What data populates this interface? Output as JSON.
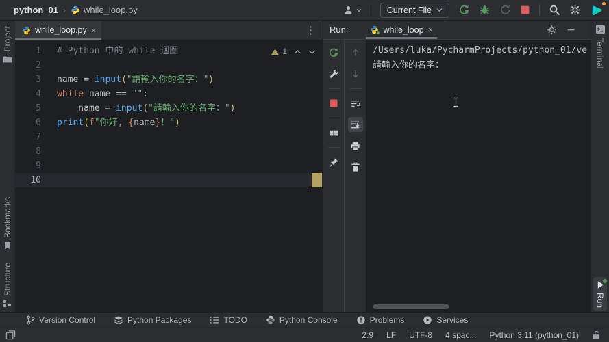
{
  "titlebar": {
    "project": "python_01",
    "breadcrumb_separator": "›",
    "breadcrumb_file": "while_loop.py",
    "run_config": "Current File"
  },
  "editor": {
    "tab_label": "while_loop.py",
    "tab_close": "×",
    "more_menu": "⋮",
    "warning_count": "1",
    "lines": [
      {
        "n": "1",
        "tokens": [
          {
            "c": "comment",
            "t": "# Python 中的 while 迴圈"
          }
        ]
      },
      {
        "n": "2",
        "tokens": []
      },
      {
        "n": "3",
        "tokens": [
          {
            "c": "plain",
            "t": "name = "
          },
          {
            "c": "fn",
            "t": "input"
          },
          {
            "c": "par",
            "t": "("
          },
          {
            "c": "str",
            "t": "\"請輸入你的名字：\""
          },
          {
            "c": "par",
            "t": ")"
          }
        ]
      },
      {
        "n": "4",
        "tokens": [
          {
            "c": "kw",
            "t": "while "
          },
          {
            "c": "plain",
            "t": "name == "
          },
          {
            "c": "str",
            "t": "\"\""
          },
          {
            "c": "plain",
            "t": ":"
          }
        ]
      },
      {
        "n": "5",
        "tokens": [
          {
            "c": "plain",
            "t": "    name = "
          },
          {
            "c": "fn",
            "t": "input"
          },
          {
            "c": "par",
            "t": "("
          },
          {
            "c": "str",
            "t": "\"請輸入你的名字：\""
          },
          {
            "c": "par",
            "t": ")"
          }
        ]
      },
      {
        "n": "6",
        "tokens": [
          {
            "c": "fn",
            "t": "print"
          },
          {
            "c": "par",
            "t": "("
          },
          {
            "c": "kw",
            "t": "f"
          },
          {
            "c": "str",
            "t": "\"你好, "
          },
          {
            "c": "brace",
            "t": "{"
          },
          {
            "c": "plain",
            "t": "name"
          },
          {
            "c": "brace",
            "t": "}"
          },
          {
            "c": "str",
            "t": "！\""
          },
          {
            "c": "par",
            "t": ")"
          }
        ]
      },
      {
        "n": "7",
        "tokens": []
      },
      {
        "n": "8",
        "tokens": []
      },
      {
        "n": "9",
        "tokens": []
      },
      {
        "n": "10",
        "tokens": [],
        "current": true
      }
    ]
  },
  "run_panel": {
    "label": "Run:",
    "tab_label": "while_loop",
    "tab_close": "×",
    "console_lines": [
      "/Users/luka/PycharmProjects/python_01/ve",
      "請輸入你的名字："
    ]
  },
  "stripes": {
    "left": [
      {
        "label": "Project"
      },
      {
        "label": "Bookmarks"
      },
      {
        "label": "Structure"
      }
    ],
    "right_top": {
      "label": "Terminal"
    },
    "right_bottom": {
      "label": "Run"
    }
  },
  "toolbar": {
    "items": [
      {
        "label": "Version Control"
      },
      {
        "label": "Python Packages"
      },
      {
        "label": "TODO"
      },
      {
        "label": "Python Console"
      },
      {
        "label": "Problems"
      },
      {
        "label": "Services"
      }
    ]
  },
  "statusbar": {
    "caret_position": "2:9",
    "line_ending": "LF",
    "encoding": "UTF-8",
    "indent": "4 spac...",
    "interpreter": "Python 3.11 (python_01)"
  },
  "icons": {
    "user": "person silhouette",
    "rerun": "green circular arrow",
    "debug": "green bug",
    "profiler": "gray disabled circle",
    "stop": "red square",
    "search": "magnifier",
    "settings": "gear",
    "ide_logo": "teal-green triangle with orange dot",
    "python": "blue-yellow python logo",
    "lock": "open padlock"
  },
  "colors": {
    "panel_bg": "#2b2d30",
    "editor_bg": "#1e1f22",
    "green": "#57965c",
    "red": "#db5c5c",
    "warning": "#b3a262",
    "string": "#6aab73",
    "keyword": "#cf8e6d",
    "builtin": "#56a8f5"
  }
}
